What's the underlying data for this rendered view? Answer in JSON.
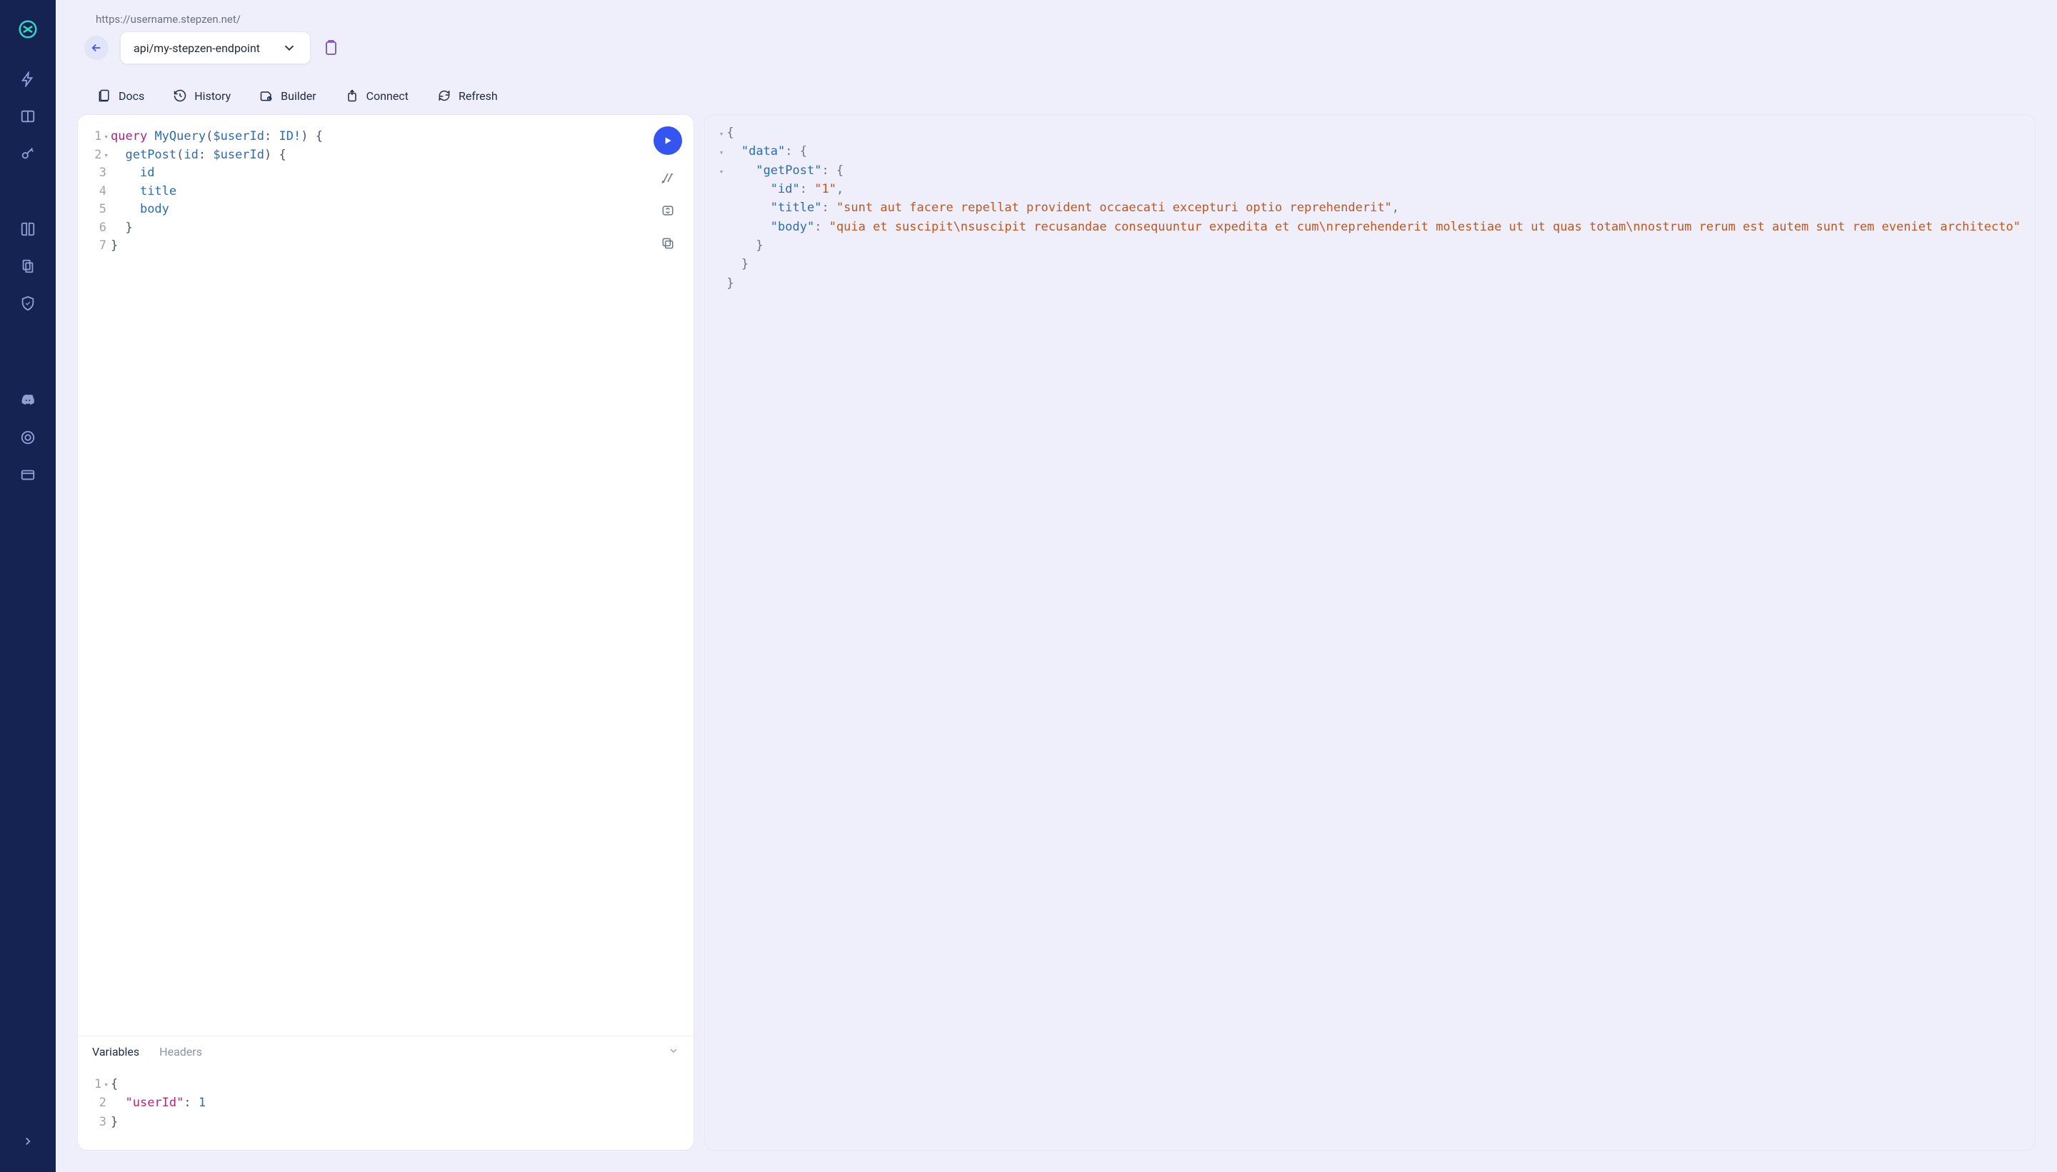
{
  "header": {
    "base_url": "https://username.stepzen.net/",
    "endpoint_selected": "api/my-stepzen-endpoint"
  },
  "toolbar": {
    "docs": "Docs",
    "history": "History",
    "builder": "Builder",
    "connect": "Connect",
    "refresh": "Refresh"
  },
  "query_editor": {
    "lines": [
      {
        "n": "1",
        "fold": true,
        "tokens": [
          {
            "c": "kw",
            "t": "query"
          },
          {
            "c": "",
            "t": " "
          },
          {
            "c": "name",
            "t": "MyQuery"
          },
          {
            "c": "punct",
            "t": "("
          },
          {
            "c": "var",
            "t": "$userId"
          },
          {
            "c": "punct",
            "t": ": "
          },
          {
            "c": "type",
            "t": "ID!"
          },
          {
            "c": "punct",
            "t": ")"
          },
          {
            "c": "",
            "t": " "
          },
          {
            "c": "brace",
            "t": "{"
          }
        ]
      },
      {
        "n": "2",
        "fold": true,
        "tokens": [
          {
            "c": "",
            "t": "  "
          },
          {
            "c": "name",
            "t": "getPost"
          },
          {
            "c": "punct",
            "t": "("
          },
          {
            "c": "field",
            "t": "id"
          },
          {
            "c": "punct",
            "t": ": "
          },
          {
            "c": "var",
            "t": "$userId"
          },
          {
            "c": "punct",
            "t": ")"
          },
          {
            "c": "",
            "t": " "
          },
          {
            "c": "brace",
            "t": "{"
          }
        ]
      },
      {
        "n": "3",
        "tokens": [
          {
            "c": "",
            "t": "    "
          },
          {
            "c": "field",
            "t": "id"
          }
        ]
      },
      {
        "n": "4",
        "tokens": [
          {
            "c": "",
            "t": "    "
          },
          {
            "c": "field",
            "t": "title"
          }
        ]
      },
      {
        "n": "5",
        "tokens": [
          {
            "c": "",
            "t": "    "
          },
          {
            "c": "field",
            "t": "body"
          }
        ]
      },
      {
        "n": "6",
        "tokens": [
          {
            "c": "",
            "t": "  "
          },
          {
            "c": "brace",
            "t": "}"
          }
        ]
      },
      {
        "n": "7",
        "tokens": [
          {
            "c": "brace",
            "t": "}"
          }
        ]
      }
    ]
  },
  "variables_section": {
    "tabs": {
      "variables": "Variables",
      "headers": "Headers"
    },
    "lines": [
      {
        "n": "1",
        "fold": true,
        "tokens": [
          {
            "c": "brace",
            "t": "{"
          }
        ]
      },
      {
        "n": "2",
        "tokens": [
          {
            "c": "",
            "t": "  "
          },
          {
            "c": "str",
            "t": "\"userId\""
          },
          {
            "c": "punct",
            "t": ": "
          },
          {
            "c": "num",
            "t": "1"
          }
        ]
      },
      {
        "n": "3",
        "tokens": [
          {
            "c": "brace",
            "t": "}"
          }
        ]
      }
    ]
  },
  "result": {
    "lines": [
      {
        "fold": true,
        "indent": 0,
        "parts": [
          {
            "c": "j-punct",
            "t": "{"
          }
        ]
      },
      {
        "fold": true,
        "indent": 1,
        "parts": [
          {
            "c": "j-key",
            "t": "\"data\""
          },
          {
            "c": "j-punct",
            "t": ": {"
          }
        ]
      },
      {
        "fold": true,
        "indent": 2,
        "parts": [
          {
            "c": "j-key",
            "t": "\"getPost\""
          },
          {
            "c": "j-punct",
            "t": ": {"
          }
        ]
      },
      {
        "indent": 3,
        "parts": [
          {
            "c": "j-key",
            "t": "\"id\""
          },
          {
            "c": "j-punct",
            "t": ": "
          },
          {
            "c": "j-str",
            "t": "\"1\""
          },
          {
            "c": "j-punct",
            "t": ","
          }
        ]
      },
      {
        "indent": 3,
        "parts": [
          {
            "c": "j-key",
            "t": "\"title\""
          },
          {
            "c": "j-punct",
            "t": ": "
          },
          {
            "c": "j-str",
            "t": "\"sunt aut facere repellat provident occaecati excepturi optio reprehenderit\""
          },
          {
            "c": "j-punct",
            "t": ","
          }
        ]
      },
      {
        "indent": 3,
        "parts": [
          {
            "c": "j-key",
            "t": "\"body\""
          },
          {
            "c": "j-punct",
            "t": ": "
          },
          {
            "c": "j-str",
            "t": "\"quia et suscipit\\nsuscipit recusandae consequuntur expedita et cum\\nreprehenderit molestiae ut ut quas totam\\nnostrum rerum est autem sunt rem eveniet architecto\""
          }
        ]
      },
      {
        "indent": 2,
        "parts": [
          {
            "c": "j-punct",
            "t": "}"
          }
        ]
      },
      {
        "indent": 1,
        "parts": [
          {
            "c": "j-punct",
            "t": "}"
          }
        ]
      },
      {
        "indent": 0,
        "parts": [
          {
            "c": "j-punct",
            "t": "}"
          }
        ]
      }
    ]
  }
}
